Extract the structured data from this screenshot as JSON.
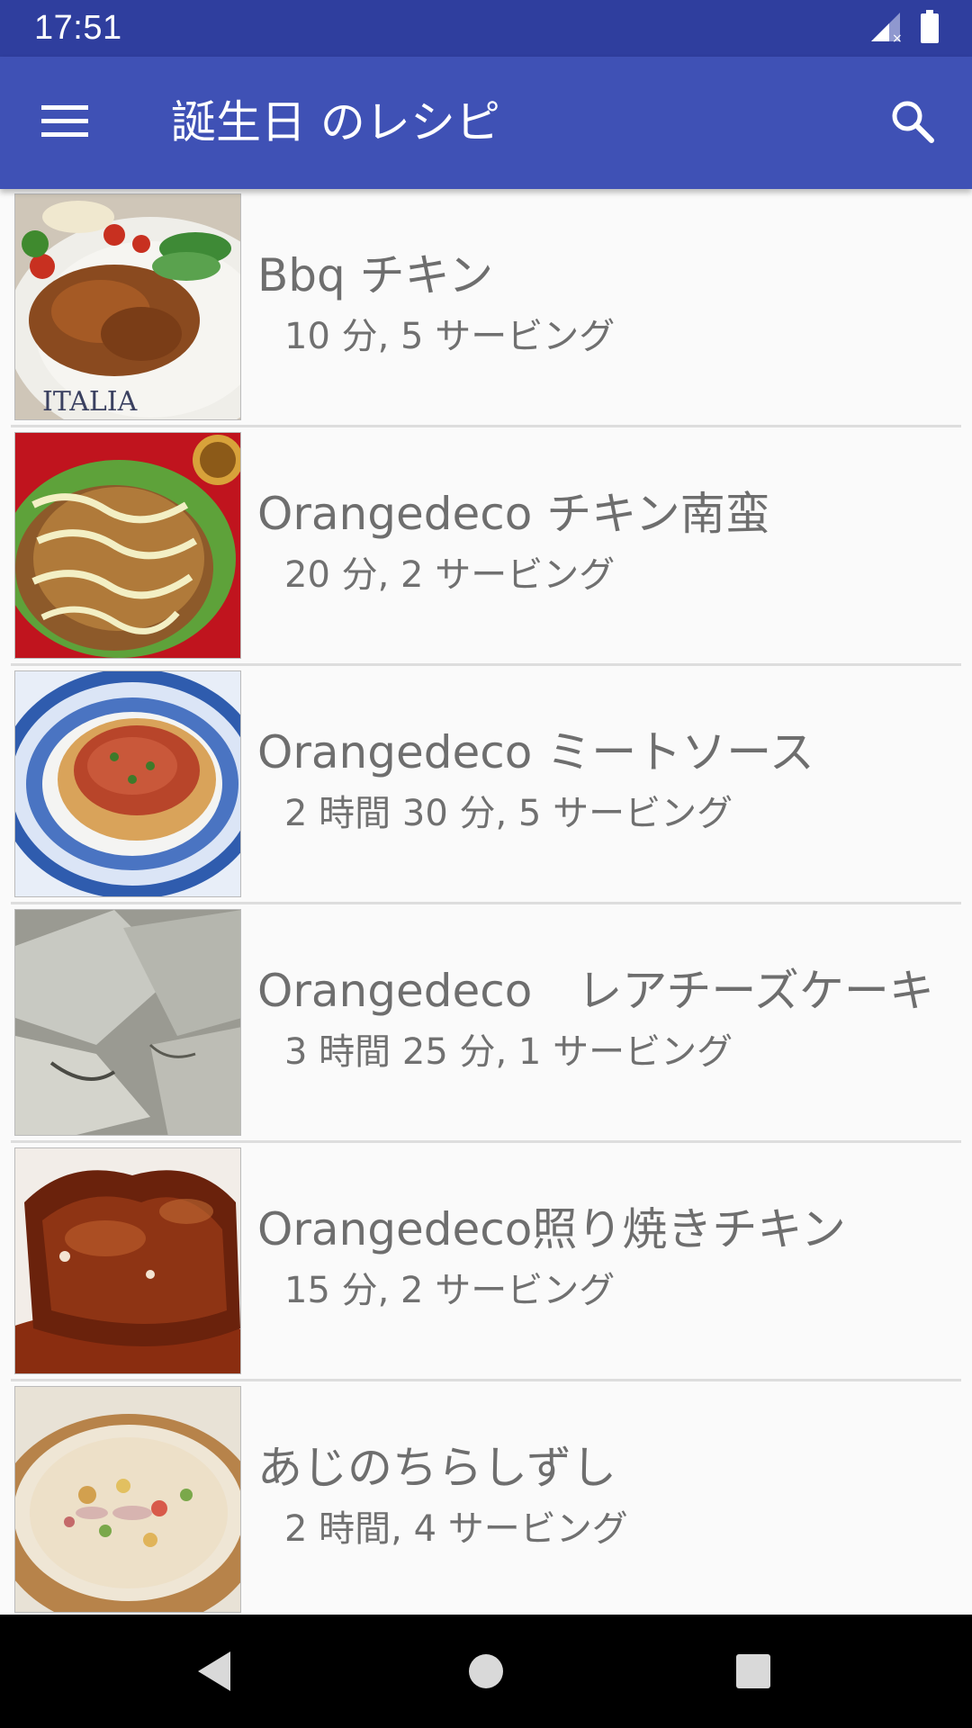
{
  "status_bar": {
    "time": "17:51"
  },
  "app_bar": {
    "title": "誕生日 のレシピ",
    "menu_icon": "hamburger-menu-icon",
    "search_icon": "search-icon"
  },
  "recipes": [
    {
      "title": "Bbq チキン",
      "subtitle": "10 分, 5 サービング"
    },
    {
      "title": "Orangedeco チキン南蛮",
      "subtitle": "20 分, 2 サービング"
    },
    {
      "title": "Orangedeco ミートソース",
      "subtitle": "2 時間 30 分, 5 サービング"
    },
    {
      "title": "Orangedeco　レアチーズケーキ",
      "subtitle": "3 時間 25 分, 1 サービング"
    },
    {
      "title": "Orangedeco照り焼きチキン",
      "subtitle": "15 分, 2 サービング"
    },
    {
      "title": "あじのちらしずし",
      "subtitle": "2 時間, 4 サービング"
    }
  ],
  "colors": {
    "status_bar": "#2f3e9e",
    "app_bar": "#3f51b5",
    "background": "#fafafa",
    "text_primary": "#6e6e6e",
    "nav_bar": "#000000"
  }
}
